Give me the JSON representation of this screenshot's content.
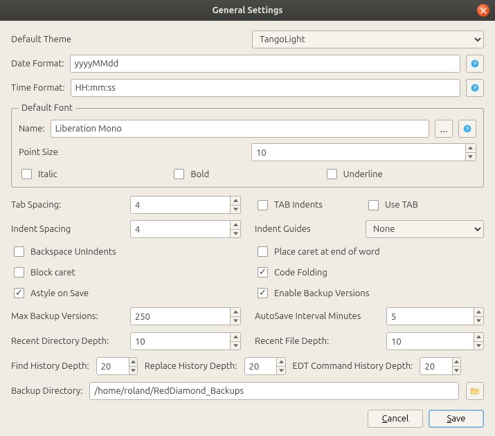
{
  "title": "General Settings",
  "theme": {
    "label": "Default Theme",
    "value": "TangoLight"
  },
  "dateFormat": {
    "label": "Date Format:",
    "value": "yyyyMMdd"
  },
  "timeFormat": {
    "label": "Time Format:",
    "value": "HH:mm:ss"
  },
  "font": {
    "legend": "Default Font",
    "nameLabel": "Name:",
    "name": "Liberation Mono",
    "browse": "...",
    "pointSizeLabel": "Point Size",
    "pointSize": "10",
    "italic": "Italic",
    "bold": "Bold",
    "underline": "Underline"
  },
  "tabSpacing": {
    "label": "Tab Spacing:",
    "value": "4"
  },
  "tabIndents": "TAB Indents",
  "useTab": "Use TAB",
  "indentSpacing": {
    "label": "Indent Spacing",
    "value": "4"
  },
  "indentGuides": {
    "label": "Indent Guides",
    "value": "None"
  },
  "backspaceUnindents": "Backspace UnIndents",
  "placeCaretEOW": "Place caret at end of word",
  "blockCaret": "Block caret",
  "codeFolding": "Code Folding",
  "astyleOnSave": "Astyle on Save",
  "enableBackup": "Enable Backup Versions",
  "maxBackup": {
    "label": "Max Backup Versions:",
    "value": "250"
  },
  "autoSave": {
    "label": "AutoSave Interval Minutes",
    "value": "5"
  },
  "recentDirDepth": {
    "label": "Recent Directory Depth:",
    "value": "10"
  },
  "recentFileDepth": {
    "label": "Recent File Depth:",
    "value": "10"
  },
  "findHistory": {
    "label": "Find History Depth:",
    "value": "20"
  },
  "replaceHistory": {
    "label": "Replace History Depth:",
    "value": "20"
  },
  "edtHistory": {
    "label": "EDT Command History Depth:",
    "value": "20"
  },
  "backupDir": {
    "label": "Backup Directory:",
    "value": "/home/roland/RedDiamond_Backups"
  },
  "buttons": {
    "cancel": "Cancel",
    "save": "Save"
  }
}
